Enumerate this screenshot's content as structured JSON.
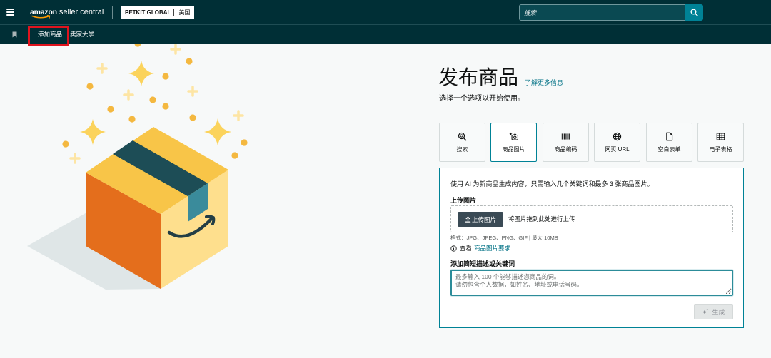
{
  "header": {
    "menu_icon": "hamburger-icon",
    "logo": {
      "brand": "amazon",
      "product": "seller central"
    },
    "account": {
      "name": "PETKIT GLOBAL",
      "region": "美国"
    },
    "search": {
      "placeholder": "搜索",
      "button_icon": "search-icon"
    }
  },
  "nav": {
    "bookmark_icon": "bookmark-icon",
    "items": [
      {
        "label": "添加商品",
        "highlighted": true
      },
      {
        "label": "卖家大学",
        "highlighted": false
      }
    ]
  },
  "main": {
    "title": "发布商品",
    "learn_more": "了解更多信息",
    "subtitle": "选择一个选项以开始使用。",
    "options": [
      {
        "label": "搜索",
        "icon": "search-icon",
        "selected": false
      },
      {
        "label": "商品图片",
        "icon": "camera-sparkle-icon",
        "selected": true
      },
      {
        "label": "商品编码",
        "icon": "barcode-icon",
        "selected": false
      },
      {
        "label": "网页 URL",
        "icon": "globe-icon",
        "selected": false
      },
      {
        "label": "空白表单",
        "icon": "document-icon",
        "selected": false
      },
      {
        "label": "电子表格",
        "icon": "spreadsheet-icon",
        "selected": false
      }
    ],
    "panel": {
      "intro": "使用 AI 为新商品生成内容，只需输入几个关键词和最多 3 张商品图片。",
      "upload_heading": "上传图片",
      "upload_button": "上传图片",
      "upload_icon": "upload-icon",
      "drop_hint": "将图片拖到此处进行上传",
      "formats": "格式：JPG、JPEG、PNG、GIF | 最大 10MB",
      "info_icon": "info-icon",
      "requirements_prefix": "查看",
      "requirements_link": "商品图片要求",
      "description_heading": "添加简短描述或关键词",
      "description_placeholder": "最多输入 100 个能够描述您商品的词。\n请勿包含个人数据，如姓名、地址或电话号码。",
      "generate_button": "生成",
      "generate_icon": "sparkle-icon"
    }
  },
  "colors": {
    "header_bg": "#002f36",
    "accent": "#008296",
    "link": "#007185",
    "highlight": "#e0141e",
    "page_bg": "#f7f9f9"
  }
}
